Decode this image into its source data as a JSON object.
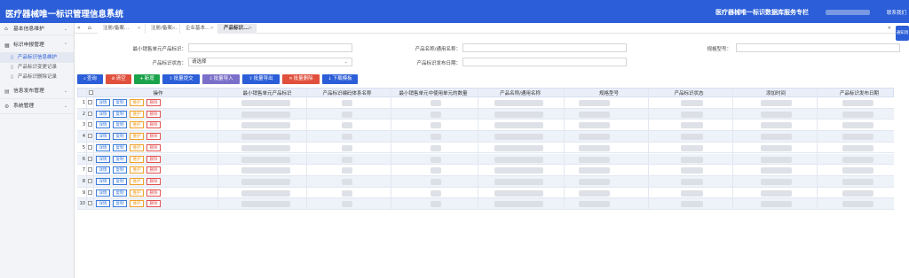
{
  "header": {
    "app_title": "医疗器械唯一标识管理信息系统",
    "menu_icon": "menu-toggle-icon",
    "db_title": "医疗器械唯一标识数据库服务专栏",
    "contact_label": "联系我们",
    "bg_color": "#2b5ed8"
  },
  "sidebar": {
    "items": [
      {
        "label": "基本信息维护",
        "icon": "home-icon"
      },
      {
        "label": "标识申报管理",
        "icon": "grid-icon"
      },
      {
        "label": "信息发布管理",
        "icon": "book-icon"
      },
      {
        "label": "系统管理",
        "icon": "settings-icon"
      }
    ],
    "sub_items": [
      {
        "label": "产品标识信息维护",
        "icon": "document-icon"
      },
      {
        "label": "产品标识变更记录",
        "icon": "document-icon"
      },
      {
        "label": "产品标识删除记录",
        "icon": "document-icon"
      }
    ]
  },
  "tabs": [
    {
      "label": "注册/备案..."
    },
    {
      "label": "注册/备案..."
    },
    {
      "label": "企业基本..."
    },
    {
      "label": "产品标识..."
    }
  ],
  "tab_nav": {
    "prev": "«",
    "home": "⌂",
    "next": "»"
  },
  "side_button": "通知消息",
  "filters": {
    "min_sales_unit_label": "最小销售单元产品标识：",
    "product_name_label": "产品名称/通用名称：",
    "model_label": "规格型号：",
    "status_label": "产品标识状态：",
    "status_value": "请选择",
    "publish_date_label": "产品标识发布日期："
  },
  "toolbar": {
    "query": "查询",
    "clear": "清空",
    "add": "新增",
    "batch_submit": "批量提交",
    "batch_import": "批量导入",
    "batch_export": "批量导出",
    "batch_delete": "批量删除",
    "download_template": "下载模板"
  },
  "table": {
    "headers": {
      "op": "操作",
      "min_unit": "最小销售单元产品标识",
      "system_name": "产品标识编码体系名称",
      "count": "最小销售单元中使用单元的数量",
      "product_name": "产品名称/通用名称",
      "model": "规格型号",
      "status": "产品标识状态",
      "add_time": "添加时间",
      "publish_date": "产品标识发布日期"
    },
    "row_actions": {
      "detail": "详情",
      "copy": "复制",
      "maintain": "维护",
      "delete": "删除"
    },
    "row_numbers": [
      "1",
      "2",
      "3",
      "4",
      "5",
      "6",
      "7",
      "8",
      "9",
      "10"
    ]
  },
  "colors": {
    "accent": "#2b5ed8",
    "query": "#2b5ed8",
    "clear": "#e0503c",
    "add": "#1aa34a",
    "batch_submit": "#2b5ed8",
    "batch_import": "#7a6fc9",
    "batch_export": "#2b5ed8",
    "batch_delete": "#e0503c",
    "download_template": "#2b5ed8",
    "detail": "#3b7bd9",
    "maintain": "#f0a028",
    "delete": "#e05050"
  }
}
